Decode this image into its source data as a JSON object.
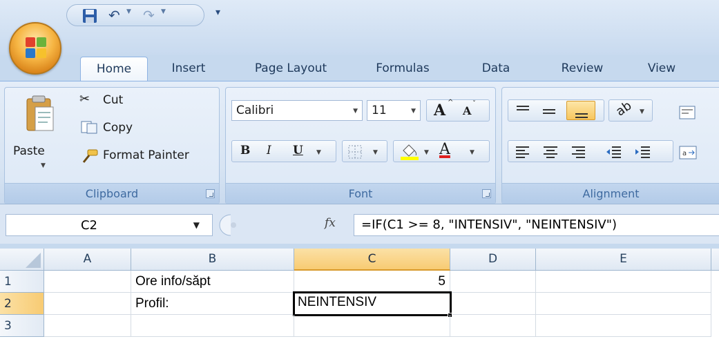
{
  "quick_access": {
    "customize_caret": "▾"
  },
  "tabs": [
    "Home",
    "Insert",
    "Page Layout",
    "Formulas",
    "Data",
    "Review",
    "View"
  ],
  "ribbon": {
    "clipboard": {
      "paste_label": "Paste",
      "cut_label": "Cut",
      "copy_label": "Copy",
      "format_painter_label": "Format Painter",
      "group_label": "Clipboard"
    },
    "font": {
      "font_name": "Calibri",
      "font_size": "11",
      "grow_label": "A",
      "shrink_label": "A",
      "bold_label": "B",
      "italic_label": "I",
      "underline_label": "U",
      "font_color_label": "A",
      "group_label": "Font"
    },
    "alignment": {
      "group_label": "Alignment"
    }
  },
  "formula_bar": {
    "name_box": "C2",
    "fx_label": "fx",
    "formula": "=IF(C1 >= 8, \"INTENSIV\", \"NEINTENSIV\")"
  },
  "sheet": {
    "columns": [
      "A",
      "B",
      "C",
      "D",
      "E"
    ],
    "rows": [
      "1",
      "2",
      "3"
    ],
    "cells": {
      "B1": "Ore info/săpt",
      "C1": "5",
      "B2": "Profil:",
      "C2": "NEINTENSIV"
    },
    "selected_cell": "C2"
  },
  "colors": {
    "accent": "#f8cb73",
    "ribbon_bg": "#dce8f6",
    "font_color_bar": "#e02020",
    "highlight_bar": "#ffff00"
  }
}
